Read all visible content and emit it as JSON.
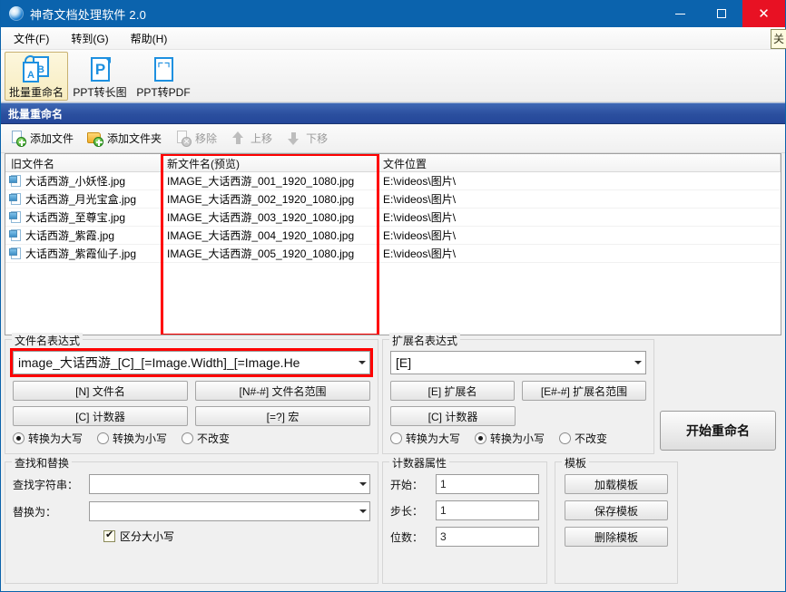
{
  "window": {
    "title": "神奇文档处理软件 2.0",
    "icon": "app-logo-icon",
    "minimize_label": "—",
    "maximize_label": "□",
    "close_label": "✕"
  },
  "menubar": {
    "items": [
      {
        "label": "文件(F)",
        "text": "文件",
        "accel": "F"
      },
      {
        "label": "转到(G)",
        "text": "转到",
        "accel": "G"
      },
      {
        "label": "帮助(H)",
        "text": "帮助",
        "accel": "H"
      }
    ],
    "right_clipped": "关"
  },
  "toolbar": {
    "buttons": [
      {
        "label": "批量重命名",
        "icon": "batch-rename-icon",
        "active": true
      },
      {
        "label": "PPT转长图",
        "icon": "ppt-to-longimage-icon",
        "active": false
      },
      {
        "label": "PPT转PDF",
        "icon": "ppt-to-pdf-icon",
        "active": false
      }
    ]
  },
  "section": {
    "title": "批量重命名"
  },
  "actions": [
    {
      "label": "添加文件",
      "icon": "add-file-icon",
      "disabled": false
    },
    {
      "label": "添加文件夹",
      "icon": "add-folder-icon",
      "disabled": false
    },
    {
      "label": "移除",
      "icon": "remove-icon",
      "disabled": true
    },
    {
      "label": "上移",
      "icon": "move-up-icon",
      "disabled": true
    },
    {
      "label": "下移",
      "icon": "move-down-icon",
      "disabled": true
    }
  ],
  "file_list": {
    "columns": [
      "旧文件名",
      "新文件名(预览)",
      "文件位置"
    ],
    "rows": [
      {
        "old": "大话西游_小妖怪.jpg",
        "new": "IMAGE_大话西游_001_1920_1080.jpg",
        "loc": "E:\\videos\\图片\\"
      },
      {
        "old": "大话西游_月光宝盒.jpg",
        "new": "IMAGE_大话西游_002_1920_1080.jpg",
        "loc": "E:\\videos\\图片\\"
      },
      {
        "old": "大话西游_至尊宝.jpg",
        "new": "IMAGE_大话西游_003_1920_1080.jpg",
        "loc": "E:\\videos\\图片\\"
      },
      {
        "old": "大话西游_紫霞.jpg",
        "new": "IMAGE_大话西游_004_1920_1080.jpg",
        "loc": "E:\\videos\\图片\\"
      },
      {
        "old": "大话西游_紫霞仙子.jpg",
        "new": "IMAGE_大话西游_005_1920_1080.jpg",
        "loc": "E:\\videos\\图片\\"
      }
    ]
  },
  "name_expression": {
    "group_title": "文件名表达式",
    "value": "image_大话西游_[C]_[=Image.Width]_[=Image.He",
    "buttons": [
      "[N] 文件名",
      "[N#-#] 文件名范围",
      "[C] 计数器",
      "[=?] 宏"
    ],
    "case_options": [
      {
        "label": "转换为大写",
        "selected": true
      },
      {
        "label": "转换为小写",
        "selected": false
      },
      {
        "label": "不改变",
        "selected": false
      }
    ]
  },
  "ext_expression": {
    "group_title": "扩展名表达式",
    "value": "[E]",
    "buttons": [
      "[E] 扩展名",
      "[E#-#] 扩展名范围",
      "[C] 计数器"
    ],
    "case_options": [
      {
        "label": "转换为大写",
        "selected": false
      },
      {
        "label": "转换为小写",
        "selected": true
      },
      {
        "label": "不改变",
        "selected": false
      }
    ]
  },
  "find_replace": {
    "group_title": "查找和替换",
    "find_label": "查找字符串：",
    "find_value": "",
    "replace_label": "替换为：",
    "replace_value": "",
    "case_sensitive_label": "区分大小写",
    "case_sensitive_checked": true
  },
  "counter": {
    "group_title": "计数器属性",
    "fields": [
      {
        "label": "开始：",
        "value": "1"
      },
      {
        "label": "步长：",
        "value": "1"
      },
      {
        "label": "位数：",
        "value": "3"
      }
    ]
  },
  "template": {
    "group_title": "模板",
    "buttons": [
      "加载模板",
      "保存模板",
      "删除模板"
    ]
  },
  "start_button": {
    "label": "开始重命名"
  },
  "colors": {
    "titlebar": "#0b63ad",
    "close": "#e81123",
    "section_header": "#2b4f9e",
    "highlight_box": "#ff0000",
    "icon_blue": "#1e90e0"
  }
}
